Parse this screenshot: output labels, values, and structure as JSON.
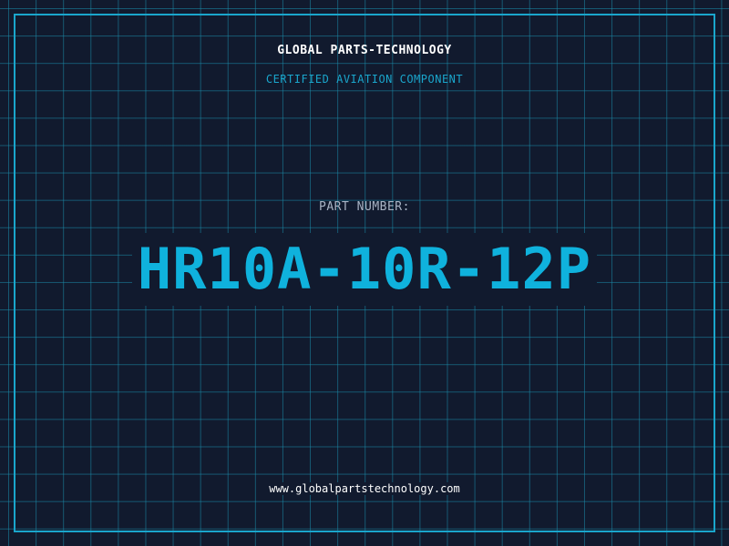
{
  "header": {
    "company_name": "GLOBAL PARTS-TECHNOLOGY",
    "subtitle": "CERTIFIED AVIATION COMPONENT"
  },
  "part": {
    "label": "PART NUMBER:",
    "number": "HR10A-10R-12P"
  },
  "footer": {
    "website": "www.globalpartstechnology.com"
  },
  "colors": {
    "background": "#111a2e",
    "accent": "#1aa6cc",
    "part_number": "#0fb2dd",
    "text": "#ffffff",
    "muted_text": "#a8b3c4"
  }
}
